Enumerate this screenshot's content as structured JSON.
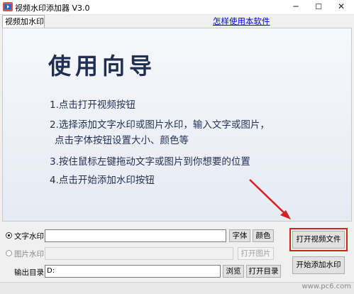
{
  "window": {
    "title": "视频水印添加器 V3.0",
    "minimize": "─",
    "maximize": "☐",
    "close": "✕"
  },
  "tabs": [
    {
      "label": "视频加水印"
    }
  ],
  "help_link": "怎样使用本软件",
  "guide": {
    "title": "使用向导",
    "steps": [
      "1.点击打开视频按钮",
      "2.选择添加文字水印或图片水印，输入文字或图片，",
      "点击字体按钮设置大小、颜色等",
      "3.按住鼠标左键拖动文字或图片到你想要的位置",
      "4.点击开始添加水印按钮"
    ]
  },
  "controls": {
    "text_watermark": {
      "label": "文字水印",
      "value": "",
      "selected": true,
      "font_button": "字体",
      "color_button": "颜色"
    },
    "image_watermark": {
      "label": "图片水印",
      "value": "",
      "selected": false,
      "open_image_button": "打开图片"
    },
    "output_dir": {
      "label": "输出目录",
      "value": "D:",
      "browse_button": "浏览",
      "open_dir_button": "打开目录"
    },
    "open_video_button": "打开视频文件",
    "start_button": "开始添加水印"
  },
  "colors": {
    "highlight_box": "#d42020",
    "arrow": "#d42020",
    "link": "#0000ee",
    "guide_text": "#233157"
  },
  "icons": {
    "app": "app-logo-icon",
    "annotation": "red-arrow-annotation"
  },
  "site_watermark": "www.pc6.com"
}
